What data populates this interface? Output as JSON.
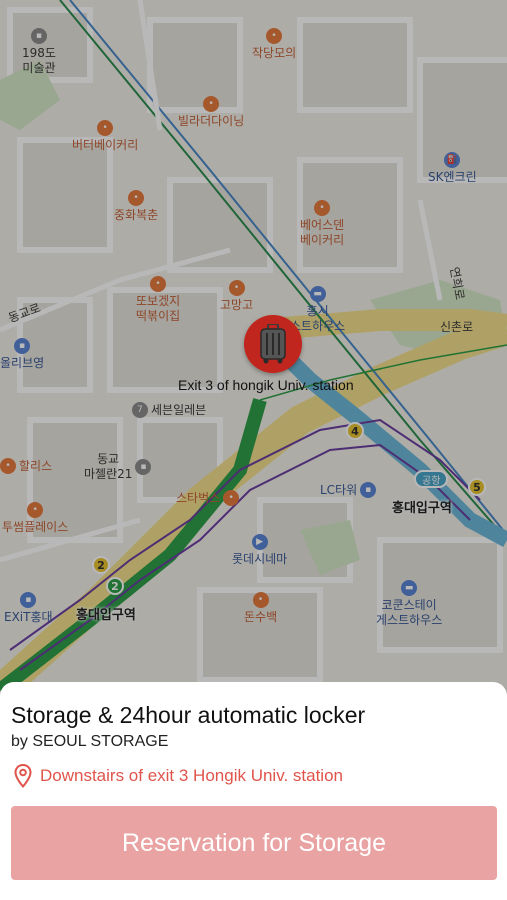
{
  "map": {
    "marker_label": "Exit 3 of hongik Univ. station",
    "pois": [
      {
        "id": "p1",
        "label": "198도\n미술관",
        "color": "grey"
      },
      {
        "id": "p2",
        "label": "작당모의",
        "color": "orange"
      },
      {
        "id": "p3",
        "label": "빌라더다이닝",
        "color": "orange"
      },
      {
        "id": "p4",
        "label": "버터베이커리",
        "color": "orange"
      },
      {
        "id": "p5",
        "label": "SK엔크린",
        "color": "blue"
      },
      {
        "id": "p6",
        "label": "중화복춘",
        "color": "orange"
      },
      {
        "id": "p7",
        "label": "베어스덴\n베이커리",
        "color": "orange"
      },
      {
        "id": "p8",
        "label": "또보겠지\n떡볶이집",
        "color": "orange"
      },
      {
        "id": "p9",
        "label": "고망고",
        "color": "orange"
      },
      {
        "id": "p10",
        "label": "홍시\n스트하우스",
        "color": "blue"
      },
      {
        "id": "p11",
        "label": "세븐일레븐",
        "color": "grey"
      },
      {
        "id": "p12",
        "label": "할리스",
        "color": "orange"
      },
      {
        "id": "p13",
        "label": "동교\n마젤란21",
        "color": "grey"
      },
      {
        "id": "p14",
        "label": "투썸플레이스",
        "color": "orange"
      },
      {
        "id": "p15",
        "label": "스타벅스",
        "color": "orange"
      },
      {
        "id": "p16",
        "label": "LC타워",
        "color": "blue"
      },
      {
        "id": "p17",
        "label": "롯데시네마",
        "color": "blue"
      },
      {
        "id": "p18",
        "label": "돈수백",
        "color": "orange"
      },
      {
        "id": "p19",
        "label": "코쿤스테이\n게스트하우스",
        "color": "blue"
      },
      {
        "id": "p20",
        "label": "EXiT홍대",
        "color": "blue"
      },
      {
        "id": "p21",
        "label": "올리브영",
        "color": "blue"
      }
    ],
    "stations": [
      {
        "id": "s1",
        "label": "홍대입구역"
      },
      {
        "id": "s2",
        "label": "홍대입구역"
      }
    ],
    "line_badges": [
      "4",
      "5",
      "2",
      "2"
    ],
    "airport_label": "공항",
    "street_labels": [
      "동교로",
      "신촌로",
      "연희로"
    ]
  },
  "listing": {
    "title": "Storage & 24hour automatic locker",
    "provider": "by SEOUL STORAGE",
    "location": "Downstairs of exit 3 Hongik Univ. station",
    "button_label": "Reservation for Storage"
  },
  "colors": {
    "marker": "#c0261e",
    "location_text": "#e0544b",
    "button_bg": "#e9a3a2"
  }
}
